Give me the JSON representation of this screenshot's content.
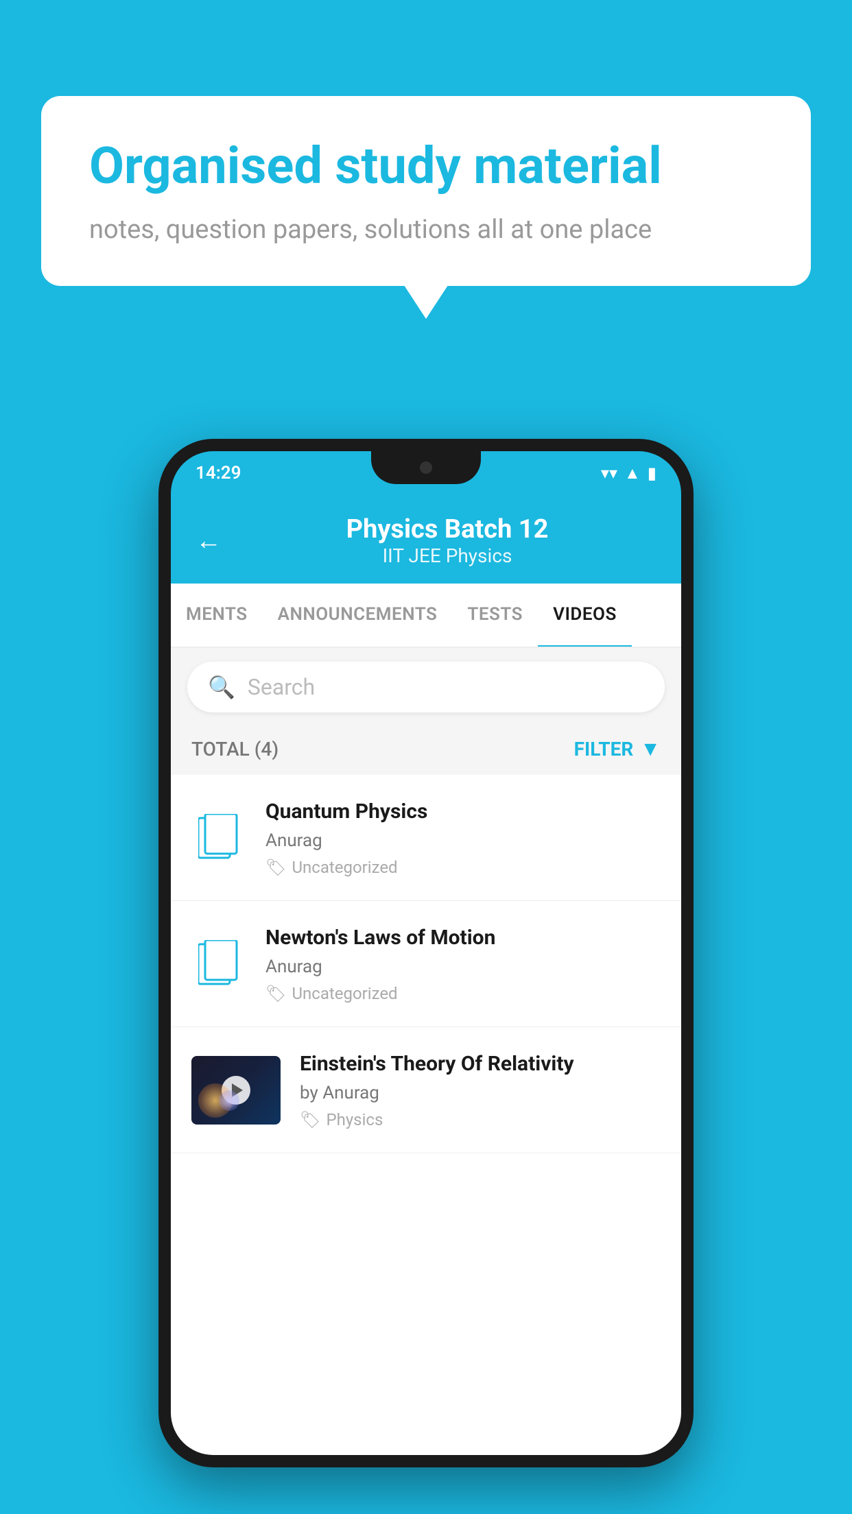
{
  "background": {
    "color": "#1bb8e0"
  },
  "speech_bubble": {
    "title": "Organised study material",
    "subtitle": "notes, question papers, solutions all at one place"
  },
  "phone": {
    "status_bar": {
      "time": "14:29"
    },
    "header": {
      "back_label": "←",
      "title": "Physics Batch 12",
      "subtitle": "IIT JEE   Physics"
    },
    "tabs": [
      {
        "label": "MENTS",
        "active": false
      },
      {
        "label": "ANNOUNCEMENTS",
        "active": false
      },
      {
        "label": "TESTS",
        "active": false
      },
      {
        "label": "VIDEOS",
        "active": true
      }
    ],
    "search": {
      "placeholder": "Search"
    },
    "filter": {
      "total_label": "TOTAL (4)",
      "filter_label": "FILTER"
    },
    "videos": [
      {
        "id": 1,
        "title": "Quantum Physics",
        "author": "Anurag",
        "tag": "Uncategorized",
        "has_thumbnail": false
      },
      {
        "id": 2,
        "title": "Newton's Laws of Motion",
        "author": "Anurag",
        "tag": "Uncategorized",
        "has_thumbnail": false
      },
      {
        "id": 3,
        "title": "Einstein's Theory Of Relativity",
        "author": "by Anurag",
        "tag": "Physics",
        "has_thumbnail": true
      }
    ]
  }
}
